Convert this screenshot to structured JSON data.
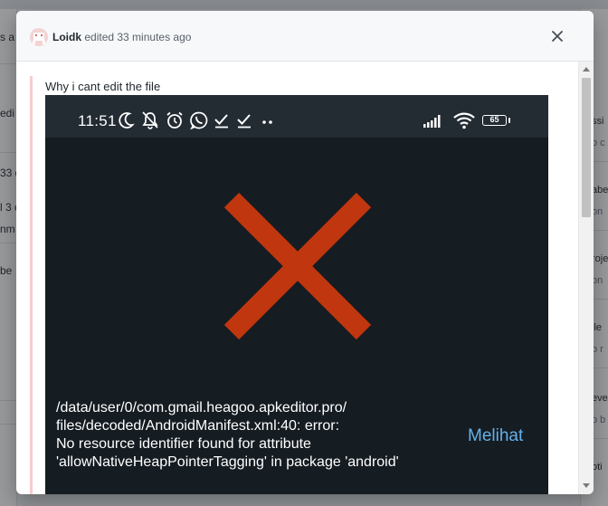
{
  "background": {
    "left_fragments": [
      "s a",
      "edi",
      "33 d",
      "l 3 c",
      "nm",
      "be"
    ],
    "right_fragments": [
      {
        "text": "ssi",
        "tone": "dark"
      },
      {
        "text": "o c",
        "tone": "muted"
      },
      {
        "text": "abe",
        "tone": "dark"
      },
      {
        "text": "on",
        "tone": "muted"
      },
      {
        "text": "roje",
        "tone": "dark"
      },
      {
        "text": "on",
        "tone": "muted"
      },
      {
        "text": "ile",
        "tone": "dark"
      },
      {
        "text": "o r",
        "tone": "muted"
      },
      {
        "text": "eve",
        "tone": "dark"
      },
      {
        "text": "o b",
        "tone": "muted"
      },
      {
        "text": "oti",
        "tone": "dark"
      }
    ]
  },
  "modal": {
    "author": "Loidk",
    "action_text": "edited 33 minutes ago",
    "close_label": "×",
    "body_text": "Why i cant edit the file",
    "screenshot": {
      "clock": "11:51",
      "status_icons": [
        "moon-icon",
        "bell-off-icon",
        "alarm-icon",
        "whatsapp-icon",
        "check-icon",
        "check-icon",
        "more-dots-icon"
      ],
      "system_icons": [
        "signal-icon",
        "wifi-icon",
        "battery-icon"
      ],
      "battery_level": "65",
      "error_icon": "error-x-icon",
      "error_color": "#c0360f",
      "error_lines": [
        "/data/user/0/com.gmail.heagoo.apkeditor.pro/",
        "files/decoded/AndroidManifest.xml:40: error:",
        "No resource identifier found for attribute",
        "'allowNativeHeapPointerTagging' in package 'android'"
      ],
      "view_button": "Melihat",
      "view_button_color": "#64b1e8"
    }
  }
}
